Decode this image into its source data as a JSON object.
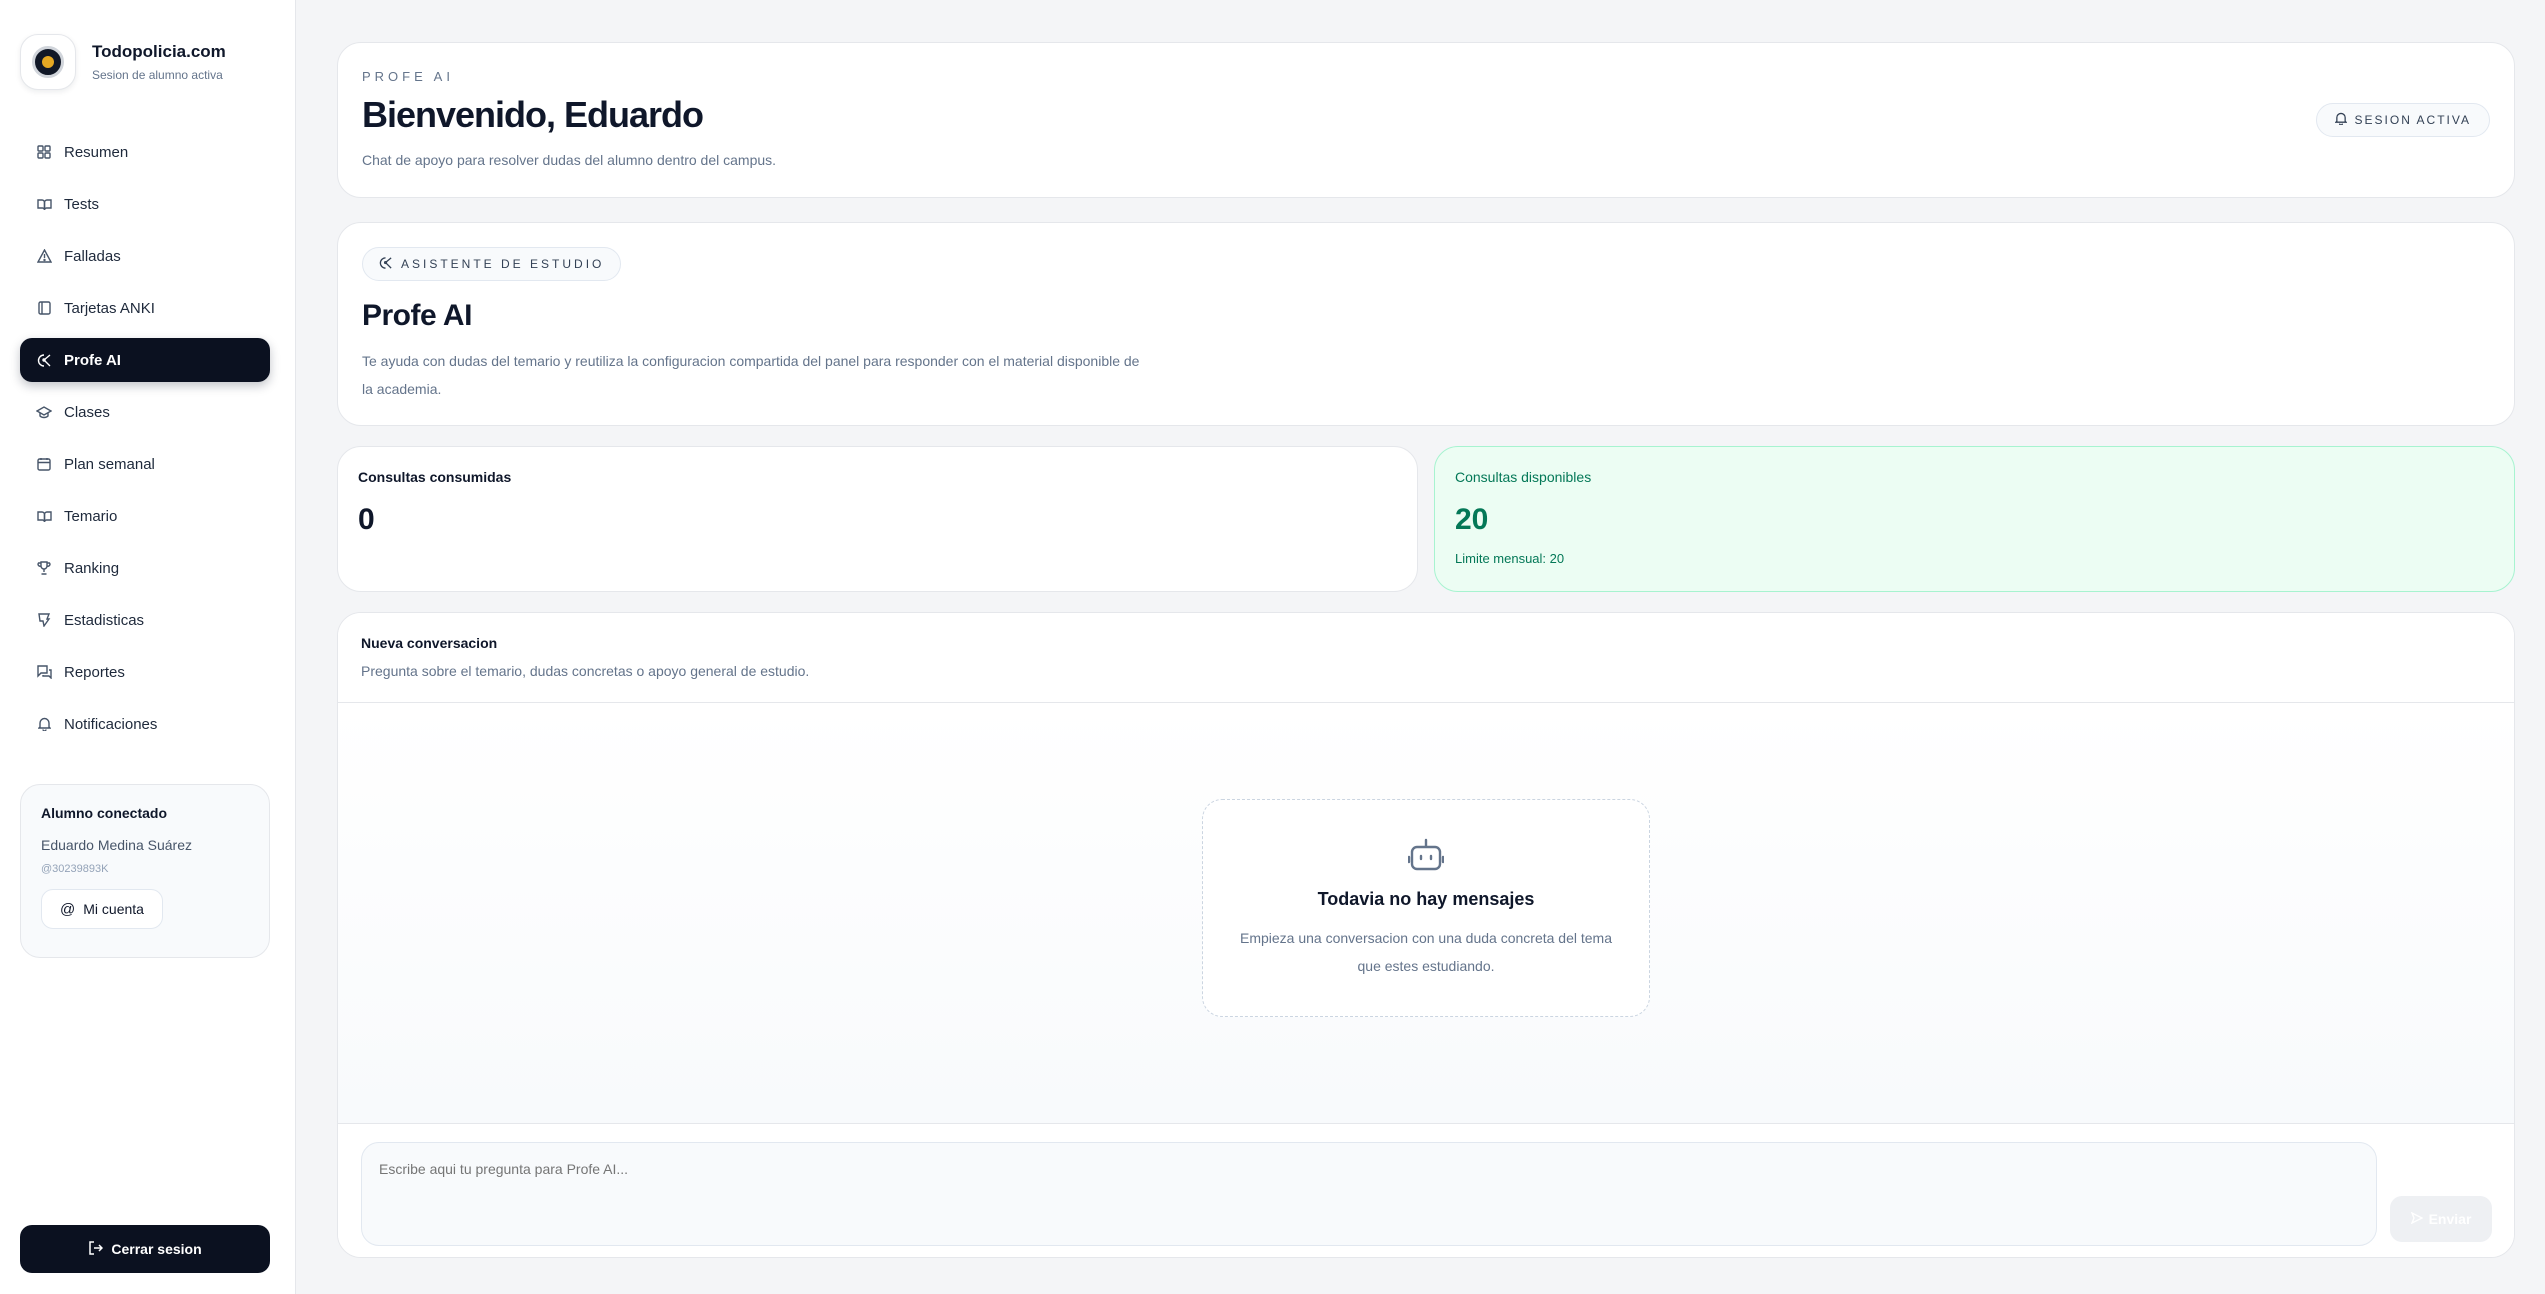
{
  "brand": {
    "title": "Todopolicia.com",
    "subtitle": "Sesion de alumno activa"
  },
  "sidebar": {
    "items": [
      {
        "label": "Resumen",
        "icon": "grid-icon"
      },
      {
        "label": "Tests",
        "icon": "book-open-icon"
      },
      {
        "label": "Falladas",
        "icon": "warning-triangle-icon"
      },
      {
        "label": "Tarjetas ANKI",
        "icon": "cards-icon"
      },
      {
        "label": "Profe AI",
        "icon": "ai-brain-icon",
        "active": true
      },
      {
        "label": "Clases",
        "icon": "graduation-cap-icon"
      },
      {
        "label": "Plan semanal",
        "icon": "calendar-icon"
      },
      {
        "label": "Temario",
        "icon": "book-icon"
      },
      {
        "label": "Ranking",
        "icon": "trophy-icon"
      },
      {
        "label": "Estadisticas",
        "icon": "chart-icon"
      },
      {
        "label": "Reportes",
        "icon": "report-icon"
      },
      {
        "label": "Notificaciones",
        "icon": "bell-icon"
      }
    ],
    "user_card": {
      "title": "Alumno conectado",
      "name": "Eduardo Medina Suárez",
      "id": "@30239893K",
      "account_label": "Mi cuenta"
    },
    "logout_label": "Cerrar sesion"
  },
  "header": {
    "eyebrow": "PROFE AI",
    "title": "Bienvenido, Eduardo",
    "description": "Chat de apoyo para resolver dudas del alumno dentro del campus.",
    "session_label": "SESION ACTIVA"
  },
  "assistant": {
    "pill": "ASISTENTE DE ESTUDIO",
    "title": "Profe AI",
    "description": "Te ayuda con dudas del temario y reutiliza la configuracion compartida del panel para responder con el material disponible de la academia."
  },
  "stats": {
    "used": {
      "label": "Consultas consumidas",
      "value": "0"
    },
    "available": {
      "label": "Consultas disponibles",
      "value": "20",
      "note": "Limite mensual: 20"
    }
  },
  "chat": {
    "title": "Nueva conversacion",
    "description": "Pregunta sobre el temario, dudas concretas o apoyo general de estudio.",
    "empty_title": "Todavia no hay mensajes",
    "empty_description": "Empieza una conversacion con una duda concreta del tema que estes estudiando.",
    "input_placeholder": "Escribe aqui tu pregunta para Profe AI...",
    "send_label": "Enviar"
  },
  "colors": {
    "accent_dark": "#0b1120",
    "success": "#047857",
    "success_bg": "#ecfdf3"
  }
}
